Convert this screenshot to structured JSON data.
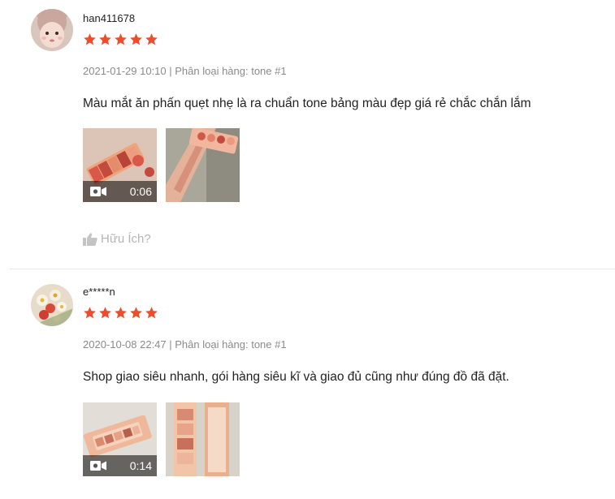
{
  "colors": {
    "star": "#ee4d2d",
    "meta": "#8a8a8a",
    "helpful": "#b5b5b5"
  },
  "reviews": [
    {
      "username": "han411678",
      "rating": 5,
      "meta": "2021-01-29 10:10 | Phân loại hàng: tone #1",
      "comment": "Màu mắt ăn phấn quẹt nhẹ là ra chuẩn tone bảng màu đẹp giá rẻ chắc chắn lắm",
      "media": [
        {
          "type": "video",
          "duration": "0:06",
          "icon": "video-camera-icon"
        },
        {
          "type": "image"
        }
      ],
      "helpful_label": "Hữu Ích?"
    },
    {
      "username": "e*****n",
      "rating": 5,
      "meta": "2020-10-08 22:47 | Phân loại hàng: tone #1",
      "comment": "Shop giao siêu nhanh, gói hàng siêu kĩ và giao đủ cũng như đúng đồ đã đặt.",
      "media": [
        {
          "type": "video",
          "duration": "0:14",
          "icon": "video-camera-icon"
        },
        {
          "type": "image"
        }
      ]
    }
  ]
}
